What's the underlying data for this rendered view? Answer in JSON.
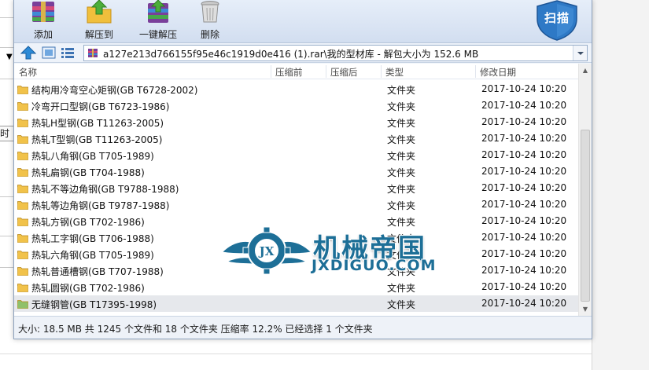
{
  "toolbar": {
    "buttons": [
      {
        "label": "添加",
        "icon": "add-archive-icon"
      },
      {
        "label": "解压到",
        "icon": "extract-to-icon"
      },
      {
        "label": "一键解压",
        "icon": "one-click-extract-icon"
      },
      {
        "label": "删除",
        "icon": "delete-icon"
      }
    ],
    "brand_label": "扫描"
  },
  "address": {
    "path": "a127e213d766155f95e46c1919d0e416 (1).rar\\我的型材库 - 解包大小为 152.6 MB"
  },
  "columns": {
    "name": "名称",
    "compressed": "压缩前",
    "after_compressed": "压缩后",
    "type": "类型",
    "modified": "修改日期"
  },
  "files": [
    {
      "name": "结构用冷弯空心矩钢(GB T6728-2002)",
      "type": "文件夹",
      "date": "2017-10-24 10:20"
    },
    {
      "name": "冷弯开口型钢(GB T6723-1986)",
      "type": "文件夹",
      "date": "2017-10-24 10:20"
    },
    {
      "name": "热轧H型钢(GB T11263-2005)",
      "type": "文件夹",
      "date": "2017-10-24 10:20"
    },
    {
      "name": "热轧T型钢(GB T11263-2005)",
      "type": "文件夹",
      "date": "2017-10-24 10:20"
    },
    {
      "name": "热轧八角钢(GB T705-1989)",
      "type": "文件夹",
      "date": "2017-10-24 10:20"
    },
    {
      "name": "热轧扁钢(GB T704-1988)",
      "type": "文件夹",
      "date": "2017-10-24 10:20"
    },
    {
      "name": "热轧不等边角钢(GB T9788-1988)",
      "type": "文件夹",
      "date": "2017-10-24 10:20"
    },
    {
      "name": "热轧等边角钢(GB T9787-1988)",
      "type": "文件夹",
      "date": "2017-10-24 10:20"
    },
    {
      "name": "热轧方钢(GB T702-1986)",
      "type": "文件夹",
      "date": "2017-10-24 10:20"
    },
    {
      "name": "热轧工字钢(GB T706-1988)",
      "type": "文件夹",
      "date": "2017-10-24 10:20"
    },
    {
      "name": "热轧六角钢(GB T705-1989)",
      "type": "文件夹",
      "date": "2017-10-24 10:20"
    },
    {
      "name": "热轧普通槽钢(GB T707-1988)",
      "type": "文件夹",
      "date": "2017-10-24 10:20"
    },
    {
      "name": "热轧圆钢(GB T702-1986)",
      "type": "文件夹",
      "date": "2017-10-24 10:20"
    },
    {
      "name": "无缝钢管(GB T17395-1998)",
      "type": "文件夹",
      "date": "2017-10-24 10:20",
      "selected": true
    }
  ],
  "status": "大小: 18.5 MB 共 1245 个文件和 18 个文件夹 压缩率 12.2% 已经选择 1 个文件夹",
  "watermark": {
    "cn": "机械帝国",
    "en": "JXDIGUO.COM",
    "emblem": "JX"
  },
  "background": {
    "stub_text": "时间"
  },
  "colors": {
    "folder": "#f1c24a",
    "brand_shield": "#2e79c6",
    "watermark": "#1d6f97",
    "selected_row": "#e6e8ec"
  }
}
